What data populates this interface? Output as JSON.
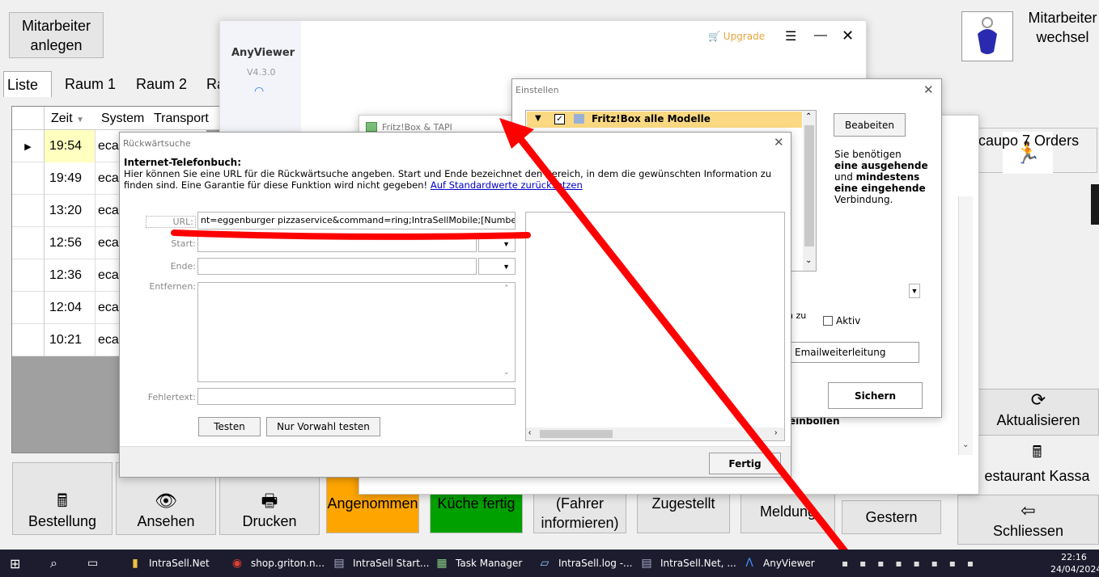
{
  "main": {
    "add_employee": "Mitarbeiter anlegen",
    "tabs": [
      "Liste",
      "Raum 1",
      "Raum 2",
      "Ra"
    ],
    "columns": [
      "Zeit",
      "System",
      "Transport"
    ],
    "rows": [
      {
        "time": "19:54",
        "system": "eca"
      },
      {
        "time": "19:49",
        "system": "eca"
      },
      {
        "time": "13:20",
        "system": "eca"
      },
      {
        "time": "12:56",
        "system": "eca"
      },
      {
        "time": "12:36",
        "system": "eca"
      },
      {
        "time": "12:04",
        "system": "eca"
      },
      {
        "time": "10:21",
        "system": "eca"
      }
    ],
    "switch_employee": "Mitarbeiter wechsel",
    "orders_label": "caupo 7 Orders",
    "refresh": "Aktualisieren",
    "restaurant_register": "estaurant Kassa",
    "close": "Schliessen",
    "yesterday": "Gestern",
    "bottom_buttons": {
      "order": "Bestellung",
      "view": "Ansehen",
      "print": "Drucken",
      "accepted": "Angenommen",
      "kitchen_done": "Küche fertig",
      "driver": "(Fahrer informieren)",
      "delivered": "Zugestellt",
      "message": "Meldung"
    },
    "colors": {
      "accepted": "#ffa500",
      "kitchen_done": "#00a000",
      "selected_row": "#ffffc0"
    }
  },
  "anyviewer": {
    "name": "AnyViewer",
    "version": "V4.3.0",
    "upgrade": "Upgrade"
  },
  "einstellen": {
    "title": "Einstellen",
    "tree_item": "Fritz!Box alle Modelle",
    "edit_button": "Beabeiten",
    "info_1": "Sie benötigen",
    "info_2": "eine ausgehende",
    "info_3": "und",
    "info_4": "mindestens",
    "info_5": "eine eingehende",
    "info_6": "Verbindung.",
    "partial_label": "n zu",
    "active": "Aktiv",
    "email_forward": "Emailweiterleitung",
    "save": "Sichern",
    "partial_text": "einbollen"
  },
  "fritz": {
    "title": "Fritz!Box & TAPI"
  },
  "reverse": {
    "title": "Rückwärtsuche",
    "heading": "Internet-Telefonbuch:",
    "desc": "Hier können Sie eine URL für die Rückwärtsuche angeben. Start und Ende bezeichnet den Bereich, in dem die gewünschten Information zu finden sind. Eine Garantie für diese Funktion wird nicht gegeben!",
    "link": "Auf Standardwerte zurücksetzen",
    "url_label": "URL:",
    "url_value": "nt=eggenburger pizzaservice&command=ring;IntraSellMobile;[Number]",
    "start_label": "Start:",
    "end_label": "Ende:",
    "remove_label": "Entfernen:",
    "error_label": "Fehlertext:",
    "test": "Testen",
    "test_prefix": "Nur Vorwahl testen",
    "done": "Fertig"
  },
  "taskbar": {
    "items": [
      "IntraSell.Net",
      "shop.griton.n...",
      "IntraSell Start...",
      "Task Manager",
      "IntraSell.log -...",
      "IntraSell.Net, ...",
      "AnyViewer"
    ],
    "time": "22:16",
    "date": "24/04/2024"
  }
}
